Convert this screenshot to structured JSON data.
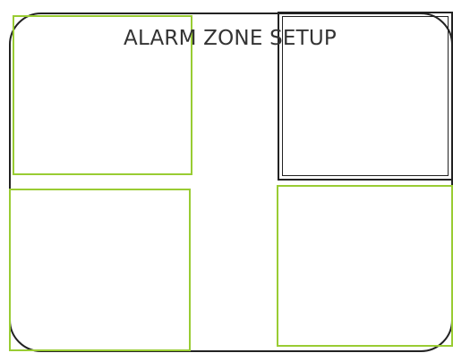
{
  "screen": {
    "title": "ALARM ZONE SETUP"
  },
  "zones": [
    {
      "id": "zone-1",
      "selected": false
    },
    {
      "id": "zone-2",
      "selected": true
    },
    {
      "id": "zone-3",
      "selected": false
    },
    {
      "id": "zone-4",
      "selected": false
    }
  ],
  "colors": {
    "zone_border": "#99cc33",
    "frame_border": "#222222",
    "selected_border": "#222222"
  }
}
